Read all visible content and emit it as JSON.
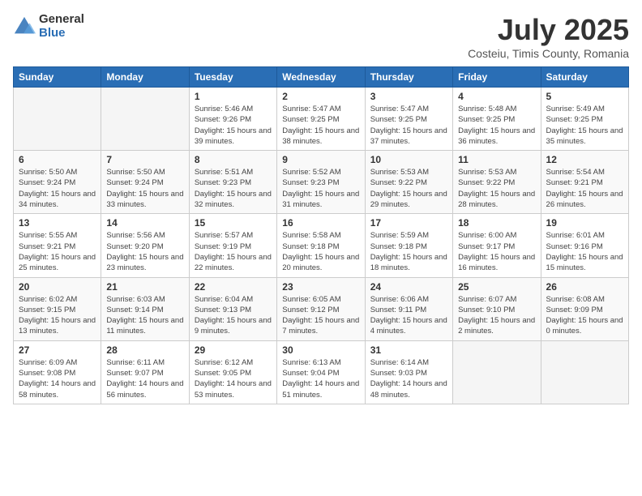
{
  "logo": {
    "general": "General",
    "blue": "Blue"
  },
  "title": "July 2025",
  "subtitle": "Costeiu, Timis County, Romania",
  "days_of_week": [
    "Sunday",
    "Monday",
    "Tuesday",
    "Wednesday",
    "Thursday",
    "Friday",
    "Saturday"
  ],
  "weeks": [
    [
      {
        "day": "",
        "info": ""
      },
      {
        "day": "",
        "info": ""
      },
      {
        "day": "1",
        "info": "Sunrise: 5:46 AM\nSunset: 9:26 PM\nDaylight: 15 hours and 39 minutes."
      },
      {
        "day": "2",
        "info": "Sunrise: 5:47 AM\nSunset: 9:25 PM\nDaylight: 15 hours and 38 minutes."
      },
      {
        "day": "3",
        "info": "Sunrise: 5:47 AM\nSunset: 9:25 PM\nDaylight: 15 hours and 37 minutes."
      },
      {
        "day": "4",
        "info": "Sunrise: 5:48 AM\nSunset: 9:25 PM\nDaylight: 15 hours and 36 minutes."
      },
      {
        "day": "5",
        "info": "Sunrise: 5:49 AM\nSunset: 9:25 PM\nDaylight: 15 hours and 35 minutes."
      }
    ],
    [
      {
        "day": "6",
        "info": "Sunrise: 5:50 AM\nSunset: 9:24 PM\nDaylight: 15 hours and 34 minutes."
      },
      {
        "day": "7",
        "info": "Sunrise: 5:50 AM\nSunset: 9:24 PM\nDaylight: 15 hours and 33 minutes."
      },
      {
        "day": "8",
        "info": "Sunrise: 5:51 AM\nSunset: 9:23 PM\nDaylight: 15 hours and 32 minutes."
      },
      {
        "day": "9",
        "info": "Sunrise: 5:52 AM\nSunset: 9:23 PM\nDaylight: 15 hours and 31 minutes."
      },
      {
        "day": "10",
        "info": "Sunrise: 5:53 AM\nSunset: 9:22 PM\nDaylight: 15 hours and 29 minutes."
      },
      {
        "day": "11",
        "info": "Sunrise: 5:53 AM\nSunset: 9:22 PM\nDaylight: 15 hours and 28 minutes."
      },
      {
        "day": "12",
        "info": "Sunrise: 5:54 AM\nSunset: 9:21 PM\nDaylight: 15 hours and 26 minutes."
      }
    ],
    [
      {
        "day": "13",
        "info": "Sunrise: 5:55 AM\nSunset: 9:21 PM\nDaylight: 15 hours and 25 minutes."
      },
      {
        "day": "14",
        "info": "Sunrise: 5:56 AM\nSunset: 9:20 PM\nDaylight: 15 hours and 23 minutes."
      },
      {
        "day": "15",
        "info": "Sunrise: 5:57 AM\nSunset: 9:19 PM\nDaylight: 15 hours and 22 minutes."
      },
      {
        "day": "16",
        "info": "Sunrise: 5:58 AM\nSunset: 9:18 PM\nDaylight: 15 hours and 20 minutes."
      },
      {
        "day": "17",
        "info": "Sunrise: 5:59 AM\nSunset: 9:18 PM\nDaylight: 15 hours and 18 minutes."
      },
      {
        "day": "18",
        "info": "Sunrise: 6:00 AM\nSunset: 9:17 PM\nDaylight: 15 hours and 16 minutes."
      },
      {
        "day": "19",
        "info": "Sunrise: 6:01 AM\nSunset: 9:16 PM\nDaylight: 15 hours and 15 minutes."
      }
    ],
    [
      {
        "day": "20",
        "info": "Sunrise: 6:02 AM\nSunset: 9:15 PM\nDaylight: 15 hours and 13 minutes."
      },
      {
        "day": "21",
        "info": "Sunrise: 6:03 AM\nSunset: 9:14 PM\nDaylight: 15 hours and 11 minutes."
      },
      {
        "day": "22",
        "info": "Sunrise: 6:04 AM\nSunset: 9:13 PM\nDaylight: 15 hours and 9 minutes."
      },
      {
        "day": "23",
        "info": "Sunrise: 6:05 AM\nSunset: 9:12 PM\nDaylight: 15 hours and 7 minutes."
      },
      {
        "day": "24",
        "info": "Sunrise: 6:06 AM\nSunset: 9:11 PM\nDaylight: 15 hours and 4 minutes."
      },
      {
        "day": "25",
        "info": "Sunrise: 6:07 AM\nSunset: 9:10 PM\nDaylight: 15 hours and 2 minutes."
      },
      {
        "day": "26",
        "info": "Sunrise: 6:08 AM\nSunset: 9:09 PM\nDaylight: 15 hours and 0 minutes."
      }
    ],
    [
      {
        "day": "27",
        "info": "Sunrise: 6:09 AM\nSunset: 9:08 PM\nDaylight: 14 hours and 58 minutes."
      },
      {
        "day": "28",
        "info": "Sunrise: 6:11 AM\nSunset: 9:07 PM\nDaylight: 14 hours and 56 minutes."
      },
      {
        "day": "29",
        "info": "Sunrise: 6:12 AM\nSunset: 9:05 PM\nDaylight: 14 hours and 53 minutes."
      },
      {
        "day": "30",
        "info": "Sunrise: 6:13 AM\nSunset: 9:04 PM\nDaylight: 14 hours and 51 minutes."
      },
      {
        "day": "31",
        "info": "Sunrise: 6:14 AM\nSunset: 9:03 PM\nDaylight: 14 hours and 48 minutes."
      },
      {
        "day": "",
        "info": ""
      },
      {
        "day": "",
        "info": ""
      }
    ]
  ]
}
